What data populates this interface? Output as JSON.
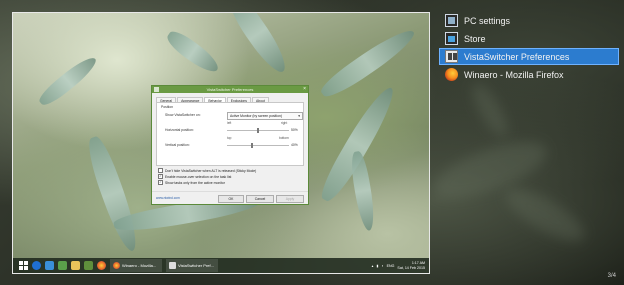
{
  "preview": {
    "dialog": {
      "title": "VistaSwitcher Preferences",
      "tabs": [
        {
          "label": "General"
        },
        {
          "label": "Appearance"
        },
        {
          "label": "Behavior"
        },
        {
          "label": "Exclusions"
        },
        {
          "label": "About"
        }
      ],
      "active_tab": "Behavior",
      "position_section": "Position",
      "show_on_label": "Show VistaSwitcher on:",
      "show_on_value": "Active Monitor (by screen position)",
      "left_label": "left",
      "right_label": "right",
      "horizontal_label": "Horizontal position:",
      "horizontal_value": "50%",
      "horizontal_percent": 50,
      "top_label": "top",
      "bottom_label": "bottom",
      "vertical_label": "Vertical position:",
      "vertical_value": "40%",
      "vertical_percent": 40,
      "checks": [
        {
          "label": "Don't hide VistaSwitcher when ALT is released (Sticky Mode)",
          "checked": false
        },
        {
          "label": "Enable mouse-over selection on the task list",
          "checked": true
        },
        {
          "label": "Show tasks only from the active monitor",
          "checked": true
        }
      ],
      "link": "www.ntwind.com",
      "ok_label": "OK",
      "cancel_label": "Cancel",
      "apply_label": "Apply"
    },
    "taskbar": {
      "tasks": [
        {
          "label": "Winaero - Mozilla..."
        },
        {
          "label": "VistaSwitcher Pref..."
        }
      ],
      "tray_lang": "ENG",
      "clock_time": "1:17 AM",
      "clock_date": "Sat, 14 Feb 2015"
    }
  },
  "window_list": [
    {
      "title": "PC settings",
      "icon": "pc-settings-icon",
      "selected": false
    },
    {
      "title": "Store",
      "icon": "store-icon",
      "selected": false
    },
    {
      "title": "VistaSwitcher Preferences",
      "icon": "vistaswitcher-icon",
      "selected": true
    },
    {
      "title": "Winaero - Mozilla Firefox",
      "icon": "firefox-icon",
      "selected": false
    }
  ],
  "counter": "3/4",
  "colors": {
    "selection": "#2c7ccf",
    "dialog_title": "#6a9a43"
  }
}
